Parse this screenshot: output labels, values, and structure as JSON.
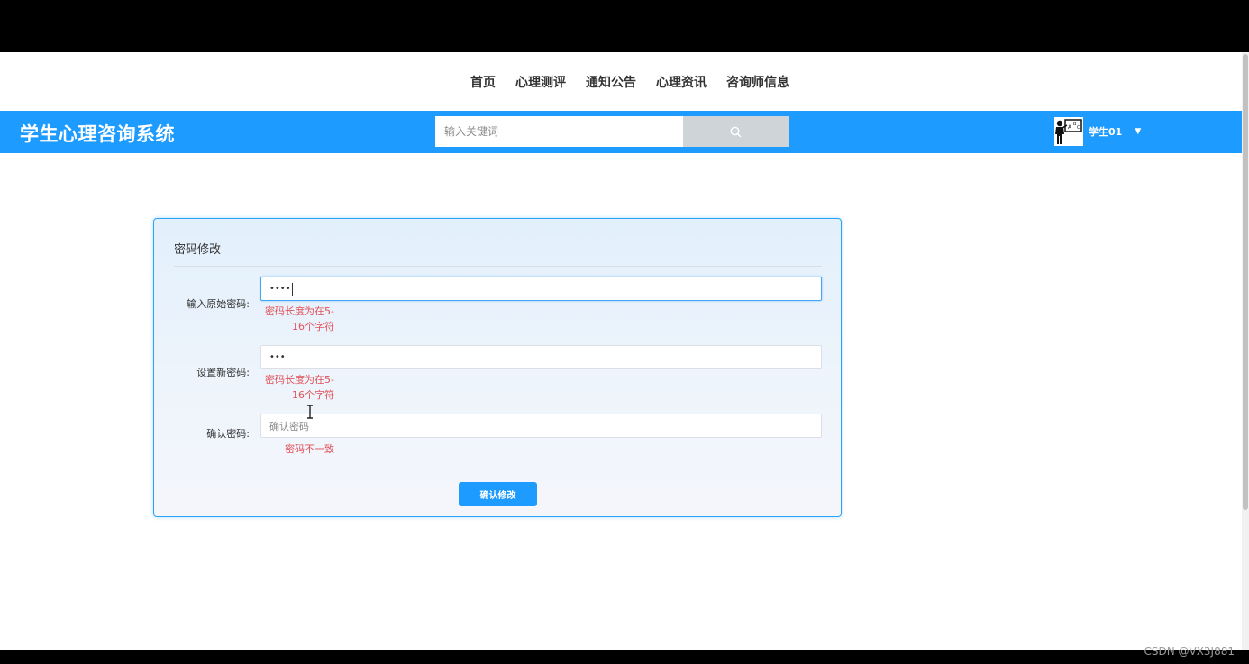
{
  "nav": {
    "items": [
      {
        "label": "首页"
      },
      {
        "label": "心理测评"
      },
      {
        "label": "通知公告"
      },
      {
        "label": "心理资讯"
      },
      {
        "label": "咨询师信息"
      }
    ]
  },
  "header": {
    "brand": "学生心理咨询系统",
    "search_placeholder": "输入关键词",
    "search_icon": "search-icon",
    "user_name": "学生01",
    "user_menu_icon": "caret-down-icon"
  },
  "form": {
    "title": "密码修改",
    "old_password": {
      "label": "输入原始密码:",
      "value_masked": "••••",
      "error_line1": "密码长度为在5-",
      "error_line2": "16个字符"
    },
    "new_password": {
      "label": "设置新密码:",
      "value_masked": "•••",
      "error_line1": "密码长度为在5-",
      "error_line2": "16个字符"
    },
    "confirm_password": {
      "label": "确认密码:",
      "placeholder": "确认密码",
      "error": "密码不一致"
    },
    "submit_label": "确认修改"
  },
  "watermark": "CSDN @VX3J881",
  "colors": {
    "accent": "#1e9bff",
    "error": "#e0525a",
    "card_border": "#2aa3f5"
  }
}
